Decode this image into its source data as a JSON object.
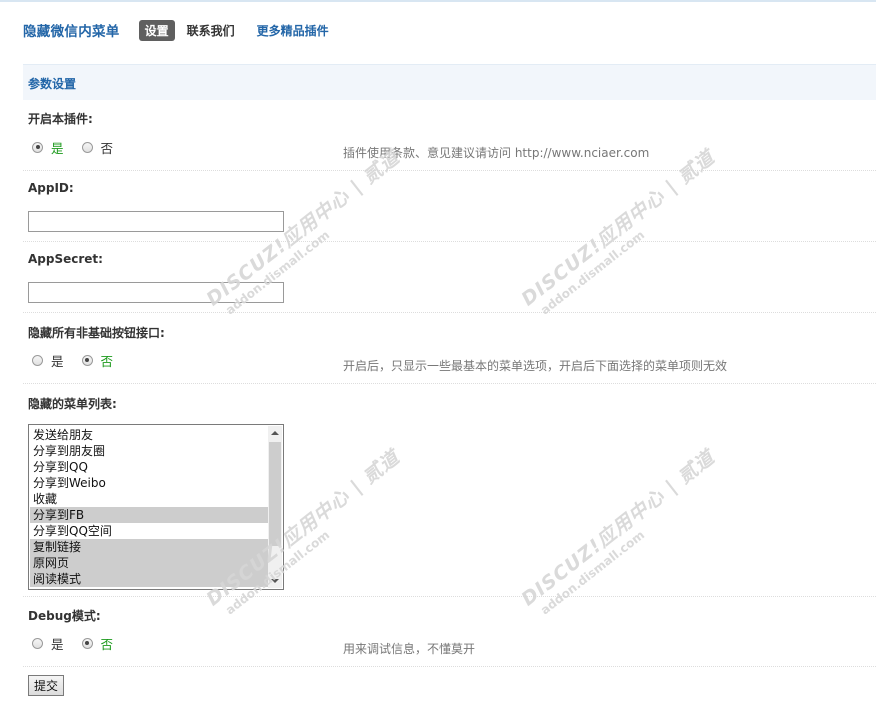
{
  "header": {
    "plugin_title": "隐藏微信内菜单",
    "tabs": [
      {
        "label": "设置"
      },
      {
        "label": "联系我们"
      },
      {
        "label": "更多精品插件"
      }
    ]
  },
  "section_title": "参数设置",
  "fields": {
    "enable": {
      "label": "开启本插件:",
      "yes": "是",
      "no": "否",
      "selected": "yes",
      "hint": "插件使用条款、意见建议请访问 http://www.nciaer.com"
    },
    "appid": {
      "label": "AppID:",
      "value": ""
    },
    "appsecret": {
      "label": "AppSecret:",
      "value": ""
    },
    "hide_non_basic": {
      "label": "隐藏所有非基础按钮接口:",
      "yes": "是",
      "no": "否",
      "selected": "no",
      "hint": "开启后，只显示一些最基本的菜单选项，开启后下面选择的菜单项则无效"
    },
    "hidden_menu_list": {
      "label": "隐藏的菜单列表:",
      "options": [
        {
          "label": "发送给朋友",
          "selected": false
        },
        {
          "label": "分享到朋友圈",
          "selected": false
        },
        {
          "label": "分享到QQ",
          "selected": false
        },
        {
          "label": "分享到Weibo",
          "selected": false
        },
        {
          "label": "收藏",
          "selected": false
        },
        {
          "label": "分享到FB",
          "selected": true
        },
        {
          "label": "分享到QQ空间",
          "selected": false
        },
        {
          "label": "复制链接",
          "selected": true
        },
        {
          "label": "原网页",
          "selected": true
        },
        {
          "label": "阅读模式",
          "selected": true
        }
      ]
    },
    "debug": {
      "label": "Debug模式:",
      "yes": "是",
      "no": "否",
      "selected": "no",
      "hint": "用来调试信息，不懂莫开"
    }
  },
  "submit_label": "提交",
  "watermark": {
    "main": "DISCUZ!应用中心 | 贰道",
    "sub": "addon.dismall.com"
  }
}
